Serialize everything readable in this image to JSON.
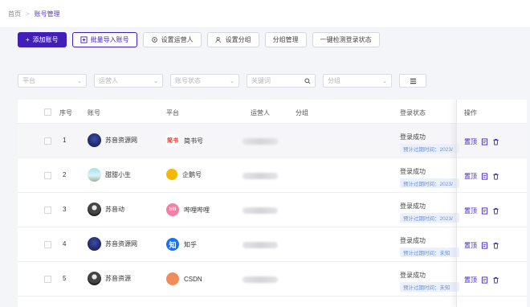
{
  "breadcrumb": {
    "home": "首页",
    "separator": ">",
    "current": "账号管理"
  },
  "toolbar": {
    "add": "添加账号",
    "batch_import": "批量导入账号",
    "set_operator": "设置运营人",
    "set_group": "设置分组",
    "group_manage": "分组管理",
    "check_login": "一键检测登录状态"
  },
  "filters": {
    "platform": "平台",
    "operator": "运营人",
    "account_status": "账号状态",
    "keyword": "关键词",
    "group": "分组"
  },
  "table": {
    "headers": {
      "index": "序号",
      "account": "账号",
      "platform": "平台",
      "operator": "运营人",
      "group": "分组",
      "login_status": "登录状态",
      "actions": "操作"
    },
    "rows": [
      {
        "index": "1",
        "account": "苏音资源网",
        "platform": "简书号",
        "platform_badge": "简书",
        "status": "登录成功",
        "status_sub": "预计过期时间：2023/",
        "pin": "置顶"
      },
      {
        "index": "2",
        "account": "甜甜小生",
        "platform": "企鹅号",
        "platform_badge": "",
        "status": "登录成功",
        "status_sub": "预计过期时间：2023/",
        "pin": "置顶"
      },
      {
        "index": "3",
        "account": "苏音动",
        "platform": "哔哩哔哩",
        "platform_badge": "bili",
        "status": "登录成功",
        "status_sub": "预计过期时间：2023/",
        "pin": "置顶"
      },
      {
        "index": "4",
        "account": "苏音资源网",
        "platform": "知乎",
        "platform_badge": "知",
        "status": "登录成功",
        "status_sub": "预计过期时间：未知",
        "pin": "置顶"
      },
      {
        "index": "5",
        "account": "苏音资源",
        "platform": "CSDN",
        "platform_badge": "",
        "status": "登录成功",
        "status_sub": "预计过期时间：未知",
        "pin": "置顶"
      }
    ]
  },
  "colors": {
    "primary": "#3f1fb8",
    "status_sub_bg": "#eaf1fd"
  }
}
